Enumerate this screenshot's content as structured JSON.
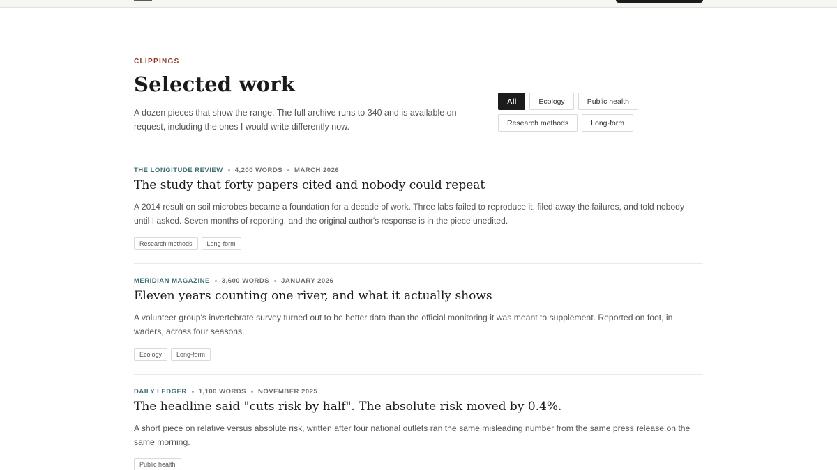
{
  "header": {
    "eyebrow": "CLIPPINGS",
    "title": "Selected work",
    "intro": "A dozen pieces that show the range. The full archive runs to 340 and is available on request, including the ones I would write differently now."
  },
  "filters": {
    "active": "All",
    "row1": [
      "All",
      "Ecology",
      "Public health"
    ],
    "row2": [
      "Research methods",
      "Long-form"
    ]
  },
  "articles": [
    {
      "publication": "THE LONGITUDE REVIEW",
      "words": "4,200 WORDS",
      "date": "MARCH 2026",
      "title": "The study that forty papers cited and nobody could repeat",
      "summary": "A 2014 result on soil microbes became a foundation for a decade of work. Three labs failed to reproduce it, filed away the failures, and told nobody until I asked. Seven months of reporting, and the original author's response is in the piece unedited.",
      "tags": [
        "Research methods",
        "Long-form"
      ]
    },
    {
      "publication": "MERIDIAN MAGAZINE",
      "words": "3,600 WORDS",
      "date": "JANUARY 2026",
      "title": "Eleven years counting one river, and what it actually shows",
      "summary": "A volunteer group's invertebrate survey turned out to be better data than the official monitoring it was meant to supplement. Reported on foot, in waders, across four seasons.",
      "tags": [
        "Ecology",
        "Long-form"
      ]
    },
    {
      "publication": "DAILY LEDGER",
      "words": "1,100 WORDS",
      "date": "NOVEMBER 2025",
      "title": "The headline said \"cuts risk by half\". The absolute risk moved by 0.4%.",
      "summary": "A short piece on relative versus absolute risk, written after four national outlets ran the same misleading number from the same press release on the same morning.",
      "tags": [
        "Public health"
      ]
    }
  ]
}
